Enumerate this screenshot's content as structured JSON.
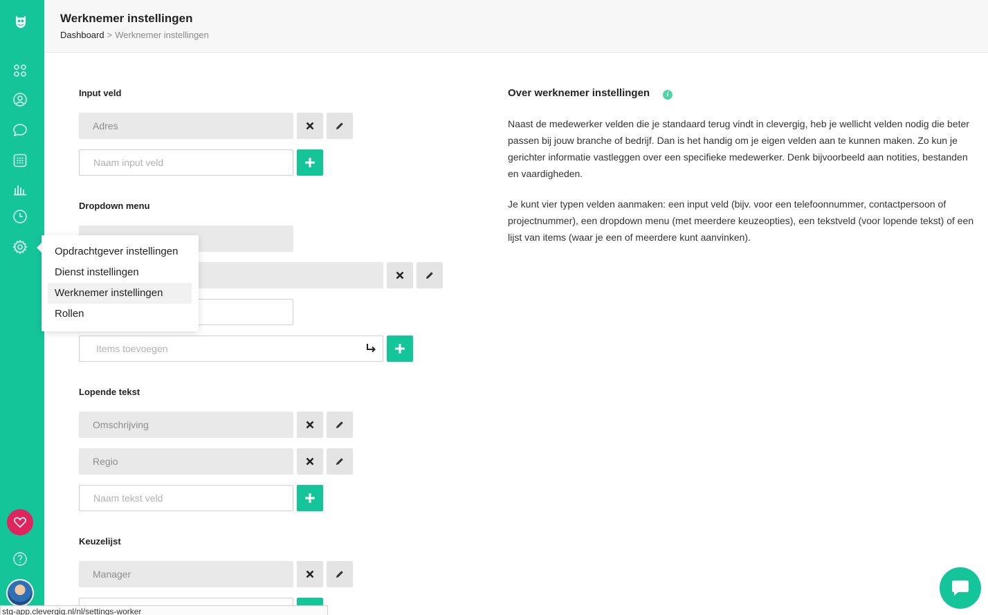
{
  "header": {
    "title": "Werknemer instellingen",
    "breadcrumb": {
      "root": "Dashboard",
      "separator": ">",
      "current": "Werknemer instellingen"
    }
  },
  "sidebar": {
    "icons": [
      "logo-icon",
      "dashboard-icon",
      "user-icon",
      "chat-icon",
      "calendar-icon",
      "chart-icon",
      "clock-icon",
      "settings-icon",
      "heart-icon",
      "help-icon",
      "avatar"
    ]
  },
  "settings_menu": {
    "items": [
      {
        "label": "Opdrachtgever instellingen",
        "active": false
      },
      {
        "label": "Dienst instellingen",
        "active": false
      },
      {
        "label": "Werknemer instellingen",
        "active": true
      },
      {
        "label": "Rollen",
        "active": false
      }
    ]
  },
  "sections": {
    "input_veld": {
      "title": "Input veld",
      "fields": [
        "Adres"
      ],
      "new_placeholder": "Naam input veld"
    },
    "dropdown": {
      "title": "Dropdown menu",
      "items_placeholder": "Items toevoegen"
    },
    "lopende_tekst": {
      "title": "Lopende tekst",
      "fields": [
        "Omschrijving",
        "Regio"
      ],
      "new_placeholder": "Naam tekst veld"
    },
    "keuzelijst": {
      "title": "Keuzelijst",
      "fields": [
        "Manager"
      ]
    }
  },
  "info": {
    "title": "Over werknemer instellingen",
    "paragraph1": "Naast de medewerker velden die je standaard terug vindt in clevergig, heb je wellicht velden nodig die beter passen bij jouw branche of bedrijf. Dan is het handig om je eigen velden aan te kunnen maken. Zo kun je gerichter informatie vastleggen over een specifieke medewerker. Denk bijvoorbeeld aan notities, bestanden en vaardigheden.",
    "paragraph2": "Je kunt vier typen velden aanmaken: een input veld (bijv. voor een telefoonnummer, contactpersoon of projectnummer), een dropdown menu (met meerdere keuzeopties), een tekstveld (voor lopende tekst) of een lijst van items (waar je een of meerdere kunt aanvinken)."
  },
  "status_bar": {
    "url": "stg-app.clevergig.nl/nl/settings-worker"
  },
  "colors": {
    "brand": "#14c59a",
    "heart": "#e0245e"
  }
}
